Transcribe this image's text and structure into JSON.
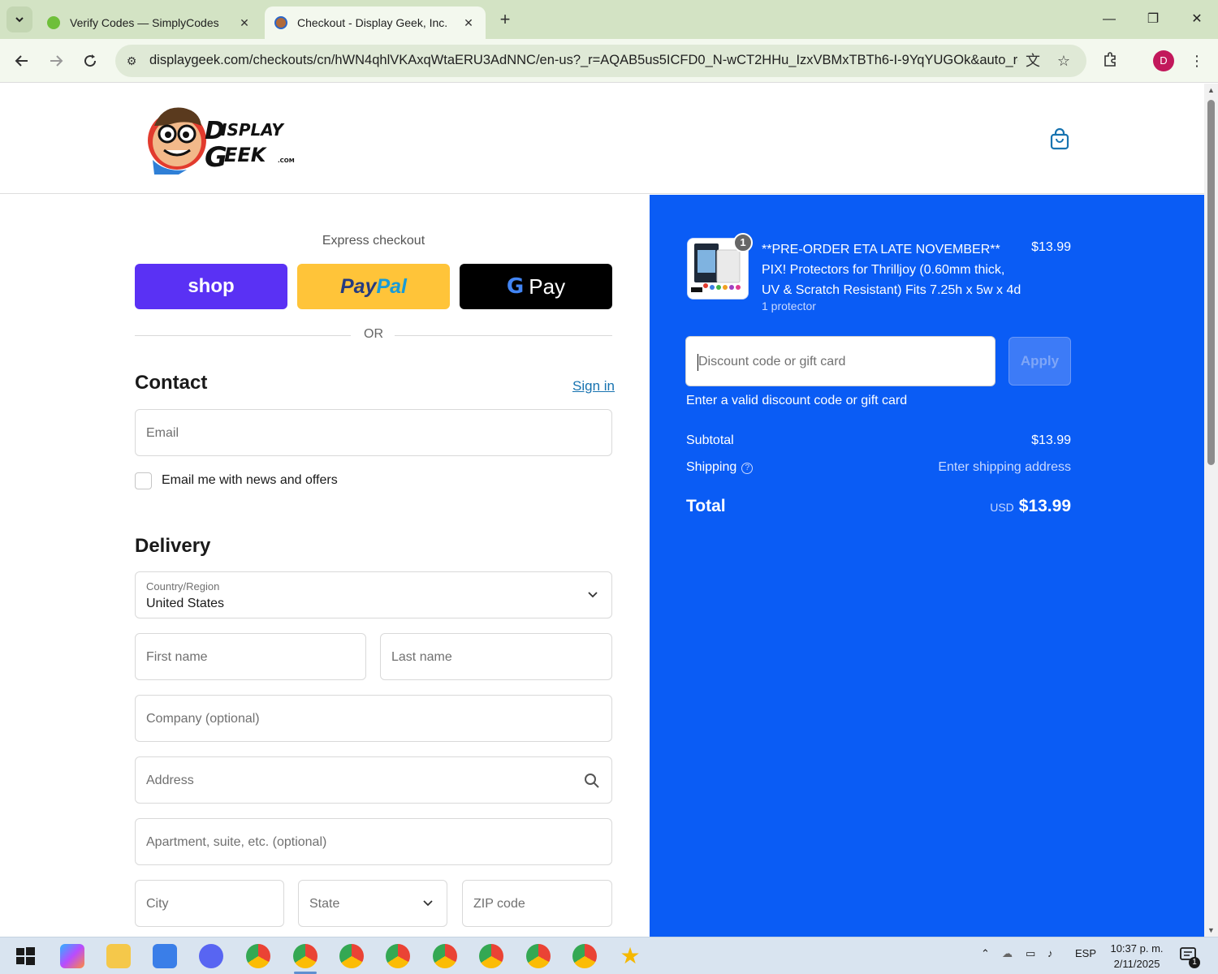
{
  "browser": {
    "tabs": [
      {
        "title": "Verify Codes — SimplyCodes",
        "active": false
      },
      {
        "title": "Checkout - Display Geek, Inc.",
        "active": true
      }
    ],
    "url_domain": "displaygeek.com",
    "url_path": "/checkouts/cn/hWN4qhlVKAxqWtaERU3AdNNC/en-us?_r=AQAB5us5ICFD0_N-wCT2HHu_IzxVBMxTBTh6-I-9YqYUGOk&auto_redi...",
    "profile_initial": "D"
  },
  "checkout": {
    "express_title": "Express checkout",
    "shop_label": "shop",
    "paypal_label_1": "Pay",
    "paypal_label_2": "Pal",
    "gpay_g": "G",
    "gpay_label": "Pay",
    "or_label": "OR",
    "contact_title": "Contact",
    "sign_in": "Sign in",
    "email_placeholder": "Email",
    "newsletter_label": "Email me with news and offers",
    "delivery_title": "Delivery",
    "country_label": "Country/Region",
    "country_value": "United States",
    "first_name_placeholder": "First name",
    "last_name_placeholder": "Last name",
    "company_placeholder": "Company (optional)",
    "address_placeholder": "Address",
    "apartment_placeholder": "Apartment, suite, etc. (optional)",
    "city_placeholder": "City",
    "state_placeholder": "State",
    "zip_placeholder": "ZIP code"
  },
  "summary": {
    "product_qty": "1",
    "product_name": "**PRE-ORDER ETA LATE NOVEMBER** PIX! Protectors for Thrilljoy (0.60mm thick, UV & Scratch Resistant) Fits 7.25h x 5w x 4d",
    "product_variant": "1 protector",
    "product_price": "$13.99",
    "discount_placeholder": "Discount code or gift card",
    "apply_label": "Apply",
    "discount_error": "Enter a valid discount code or gift card",
    "subtotal_label": "Subtotal",
    "subtotal_value": "$13.99",
    "shipping_label": "Shipping",
    "shipping_value": "Enter shipping address",
    "total_label": "Total",
    "currency": "USD",
    "total_value": "$13.99",
    "accent_color": "#0a5cf5"
  },
  "taskbar": {
    "lang": "ESP",
    "time": "10:37 p. m.",
    "date": "2/11/2025",
    "notifications": "1"
  }
}
